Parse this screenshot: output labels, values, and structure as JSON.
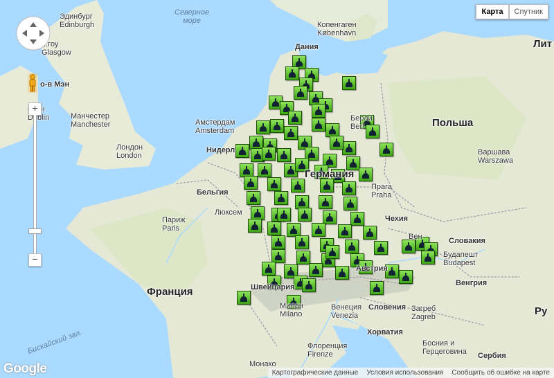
{
  "map_type_control": {
    "map": "Карта",
    "satellite": "Спутник"
  },
  "zoom_control": {
    "plus": "+",
    "minus": "−"
  },
  "google_logo": "Google",
  "footer": {
    "map_data": "Картографические данные",
    "terms": "Условия использования",
    "report_error": "Сообщить об ошибке на карте"
  },
  "labels": {
    "sea_north": "Северное\nморе",
    "sea_biscay": "Бискайский зал.",
    "edinburgh": "Эдинбург\nEdinburgh",
    "glasgow": "...гоу\nGlasgow",
    "isle_man": "о-в Мэн",
    "dublin": "блин\nDublin",
    "manchester": "Манчестер\nManchester",
    "london": "Лондон\nLondon",
    "amsterdam": "Амстердам\nAmsterdam",
    "netherlands": "Нидерл",
    "belgium": "Бельгия",
    "luxembourg": "Люксем",
    "paris": "Париж\nParis",
    "france": "Франция",
    "denmark": "Дания",
    "copenhagen": "Копенгаген\nKøbenhavn",
    "berlin": "Берли\nBerl",
    "germany": "Германия",
    "poland": "Польша",
    "warsaw": "Варшава\nWarszawa",
    "prague": "Прага\nPraha",
    "czech": "Чехия",
    "slovakia": "Словакия",
    "budapest": "Будапешт\nBudapest",
    "hungary": "Венгрия",
    "vienna": "Вен",
    "austria": "Австрия",
    "switzerland": "Швейцария",
    "milan": "Милан\nMilano",
    "venice": "Венеция\nVenezia",
    "slovenia": "Словения",
    "zagreb": "Загреб\nZagreb",
    "croatia": "Хорватия",
    "bosnia": "Босния и\nГерцеговина",
    "florence": "Флоренция\nFirenze",
    "monaco": "Монако",
    "serbia": "Сербия",
    "lithuania": "Лит",
    "romania": "Ру"
  }
}
